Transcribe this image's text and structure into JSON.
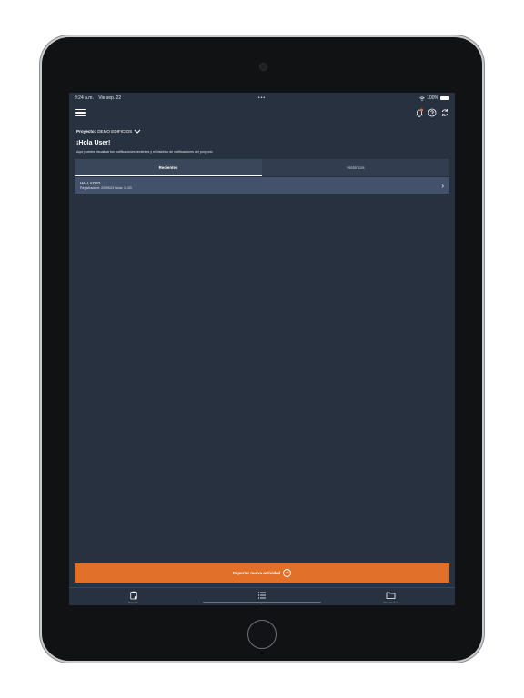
{
  "status_bar": {
    "time": "9:24 a.m.",
    "date": "Vie sep. 22",
    "battery": "100%"
  },
  "project": {
    "label": "Proyecto:",
    "name": "DEMO EDIFICIOS"
  },
  "greeting": "¡Hola User!",
  "subtitle": "Aquí puedes visualizar tus notificaciones recientes y el histórico de notificaciones del proyecto",
  "tabs": [
    {
      "label": "Recientes",
      "active": true
    },
    {
      "label": "Históricos",
      "active": false
    }
  ],
  "notifications": [
    {
      "title": "HALLAZGO",
      "meta": "Registrado el: 22/09/23   Hora: 11:03"
    }
  ],
  "report_button": {
    "label": "Reportar nueva actividad"
  },
  "tabbar": [
    {
      "label": "Reportar",
      "icon": "clipboard-icon"
    },
    {
      "label": "Integrado",
      "icon": "list-icon"
    },
    {
      "label": "Documentos",
      "icon": "folder-icon"
    }
  ],
  "colors": {
    "background": "#283140",
    "accent": "#e0702a",
    "item": "#44516a"
  }
}
